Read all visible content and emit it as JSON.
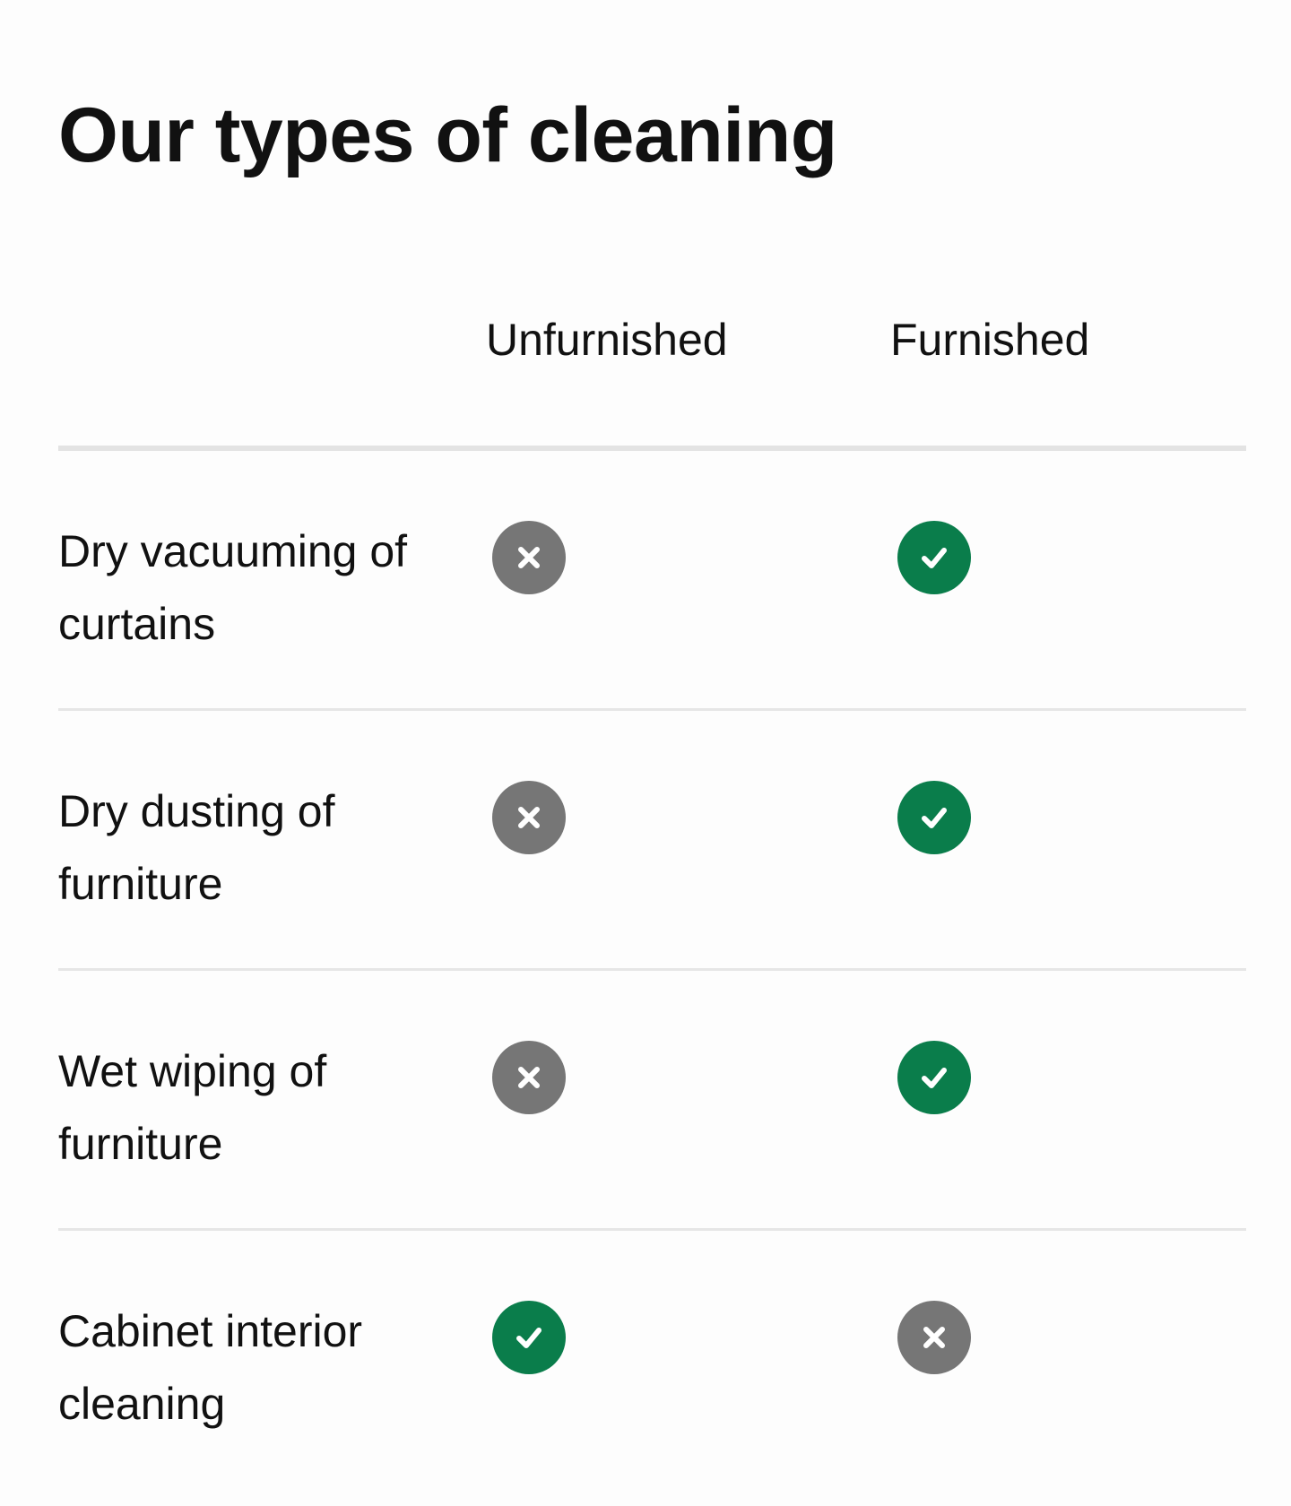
{
  "title": "Our types of cleaning",
  "columns": {
    "unfurnished": "Unfurnished",
    "furnished": "Furnished"
  },
  "colors": {
    "included": "#0a7d4b",
    "excluded": "#767676",
    "divider": "#e3e3e3"
  },
  "rows": [
    {
      "label": "Dry vacuuming of curtains",
      "unfurnished": {
        "included": false,
        "icon": "cross-icon"
      },
      "furnished": {
        "included": true,
        "icon": "check-icon"
      }
    },
    {
      "label": "Dry dusting of furniture",
      "unfurnished": {
        "included": false,
        "icon": "cross-icon"
      },
      "furnished": {
        "included": true,
        "icon": "check-icon"
      }
    },
    {
      "label": "Wet wiping of furniture",
      "unfurnished": {
        "included": false,
        "icon": "cross-icon"
      },
      "furnished": {
        "included": true,
        "icon": "check-icon"
      }
    },
    {
      "label": "Cabinet interior cleaning",
      "unfurnished": {
        "included": true,
        "icon": "check-icon"
      },
      "furnished": {
        "included": false,
        "icon": "cross-icon"
      }
    }
  ]
}
